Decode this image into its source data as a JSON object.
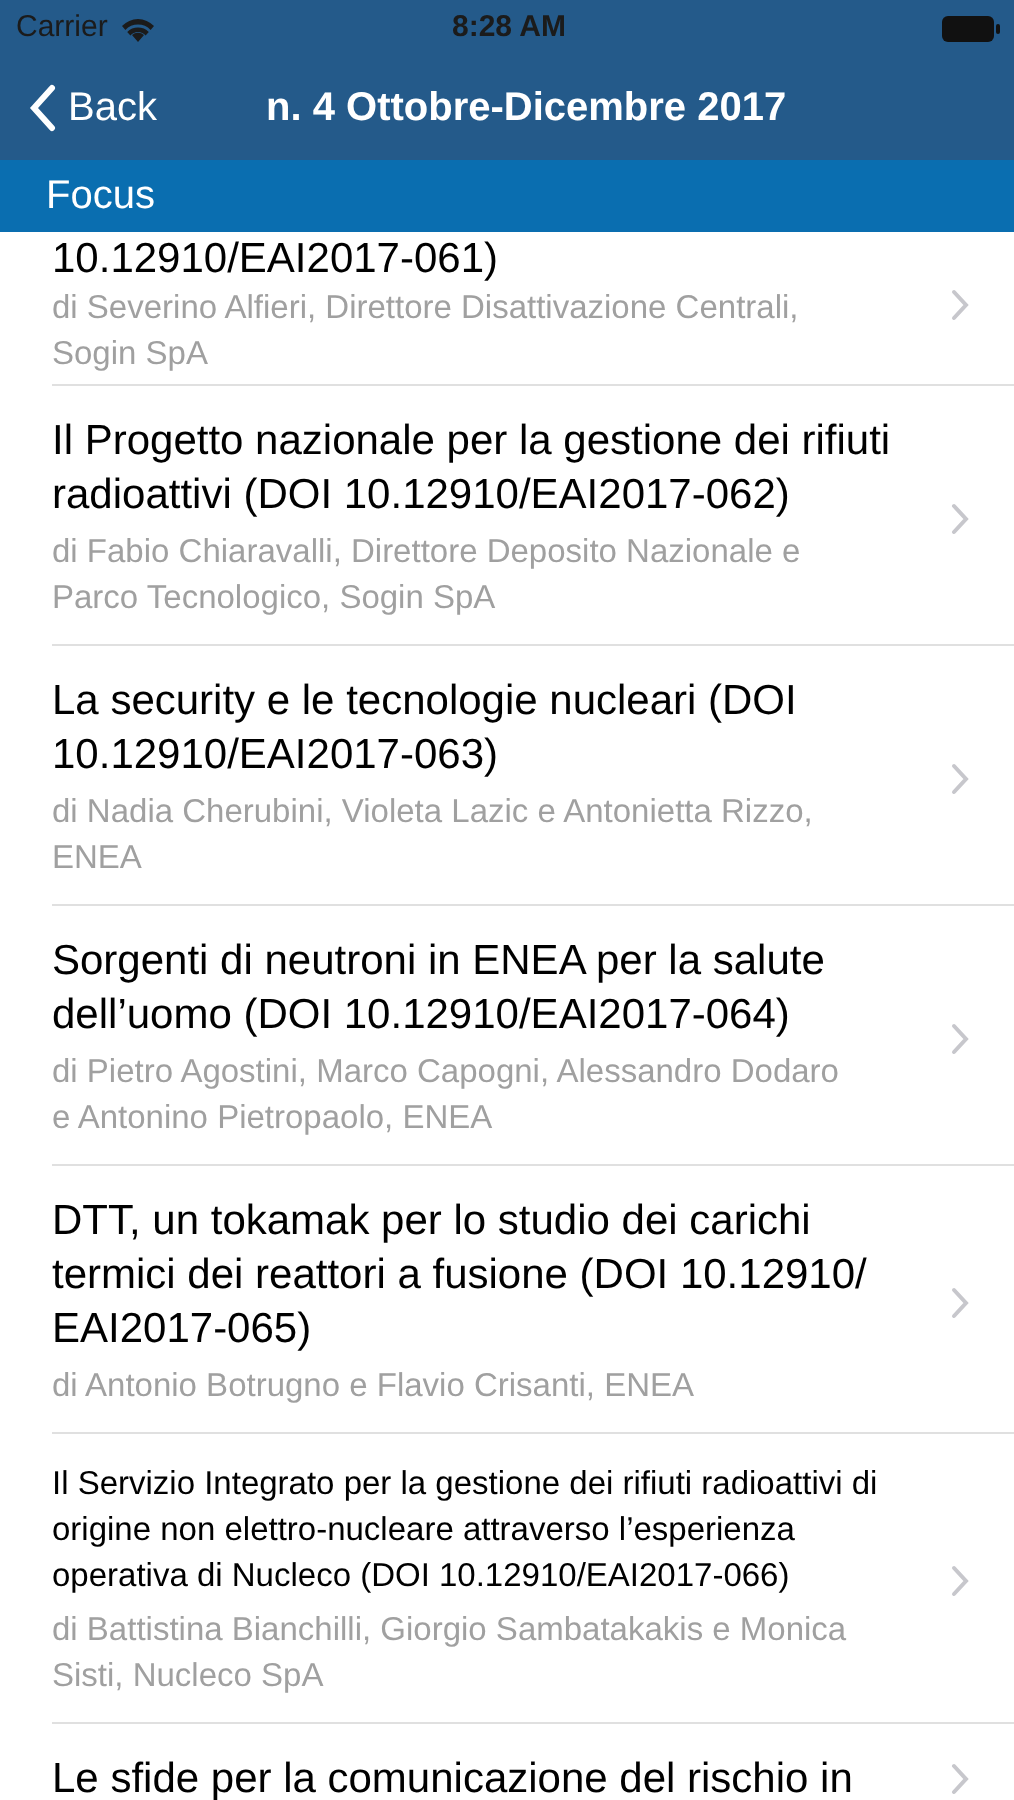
{
  "status_bar": {
    "carrier": "Carrier",
    "time": "8:28 AM"
  },
  "nav_bar": {
    "back_label": "Back",
    "title": "n. 4 Ottobre-Dicembre 2017"
  },
  "section_header": "Focus",
  "articles": [
    {
      "kind": "standard",
      "title": "10.12910/EAI2017-061)",
      "authors": "di Severino Alfieri, Direttore Disattivazione Centrali, Sogin SpA"
    },
    {
      "kind": "standard",
      "title": "Il Progetto nazionale per la gestione dei rifiuti radioattivi (DOI 10.12910/EAI2017-062)",
      "authors": "di Fabio Chiaravalli, Direttore Deposito Nazionale e Parco Tecnologico, Sogin SpA"
    },
    {
      "kind": "standard",
      "title": "La security e le tecnologie nucleari (DOI 10.12910/EAI2017-063)",
      "authors": "di Nadia Cherubini, Violeta Lazic e Antonietta Rizzo, ENEA"
    },
    {
      "kind": "standard",
      "title": "Sorgenti di neutroni in ENEA per la salute dell’uomo (DOI 10.12910/EAI2017-064)",
      "authors": "di Pietro Agostini, Marco Capogni, Alessandro Dodaro e Antonino Pietropaolo, ENEA"
    },
    {
      "kind": "standard",
      "title": "DTT, un tokamak per lo studio dei carichi termici dei reattori a fusione (DOI 10.12910/ EAI2017-065)",
      "authors": "di Antonio Botrugno e Flavio Crisanti, ENEA"
    },
    {
      "kind": "compact",
      "title": "Il Servizio Integrato per la gestione dei rifiuti radioattivi di origine non elettro-nucleare attraverso l’esperienza operativa di Nucleco (DOI 10.12910/EAI2017-066)",
      "authors": "di Battistina Bianchilli, Giorgio Sambatakakis e Monica Sisti, Nucleco SpA"
    },
    {
      "kind": "standard",
      "title": "Le sfide per la comunicazione del rischio in"
    }
  ]
}
